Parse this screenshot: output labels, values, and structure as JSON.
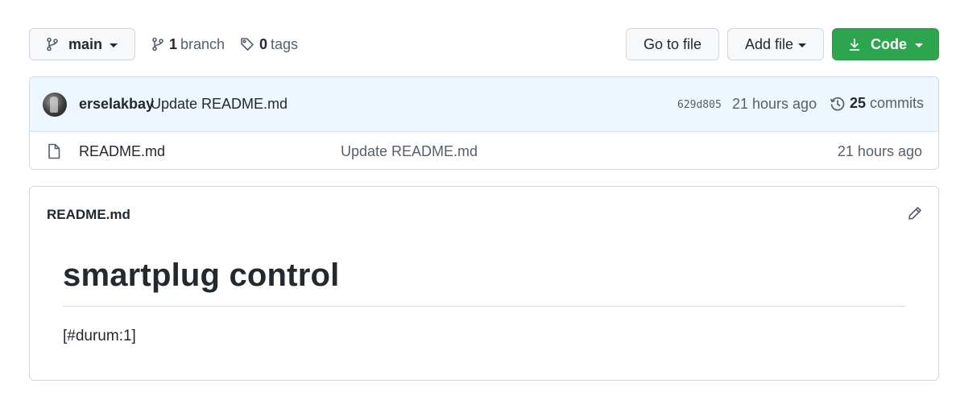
{
  "toolbar": {
    "branch_label": "main",
    "branch_count": "1",
    "branch_word": "branch",
    "tag_count": "0",
    "tag_word": "tags",
    "goto_label": "Go to file",
    "add_label": "Add file",
    "code_label": "Code"
  },
  "commit": {
    "author": "erselakbay",
    "message": "Update README.md",
    "sha": "629d805",
    "time": "21 hours ago",
    "commit_count": "25",
    "commit_word": "commits"
  },
  "files": [
    {
      "name": "README.md",
      "message": "Update README.md",
      "time": "21 hours ago"
    }
  ],
  "readme": {
    "filename": "README.md",
    "heading": "smartplug control",
    "paragraph": "[#durum:1]"
  },
  "colors": {
    "code_button": "#2da44e",
    "commit_row_bg": "#eef6ff"
  },
  "icons": {
    "branch": "git-branch-icon",
    "tag": "tag-icon",
    "download": "download-icon",
    "history": "history-icon",
    "file": "file-icon",
    "edit": "pencil-icon"
  }
}
